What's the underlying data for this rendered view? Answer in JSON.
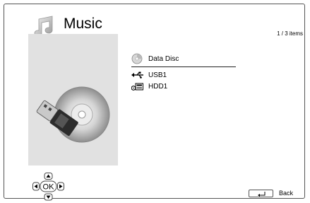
{
  "header": {
    "title": "Music",
    "icon": "music-note-icon"
  },
  "counter": "1 / 3 items",
  "sources": [
    {
      "label": "Data Disc",
      "icon": "disc-icon",
      "selected": true
    },
    {
      "label": "USB1",
      "icon": "usb-icon",
      "selected": false
    },
    {
      "label": "HDD1",
      "icon": "hdd-icon",
      "selected": false
    }
  ],
  "nav": {
    "ok_label": "OK"
  },
  "footer": {
    "back_label": "Back"
  },
  "colors": {
    "artwork_bg": "#e1e1e1",
    "frame": "#555555"
  }
}
